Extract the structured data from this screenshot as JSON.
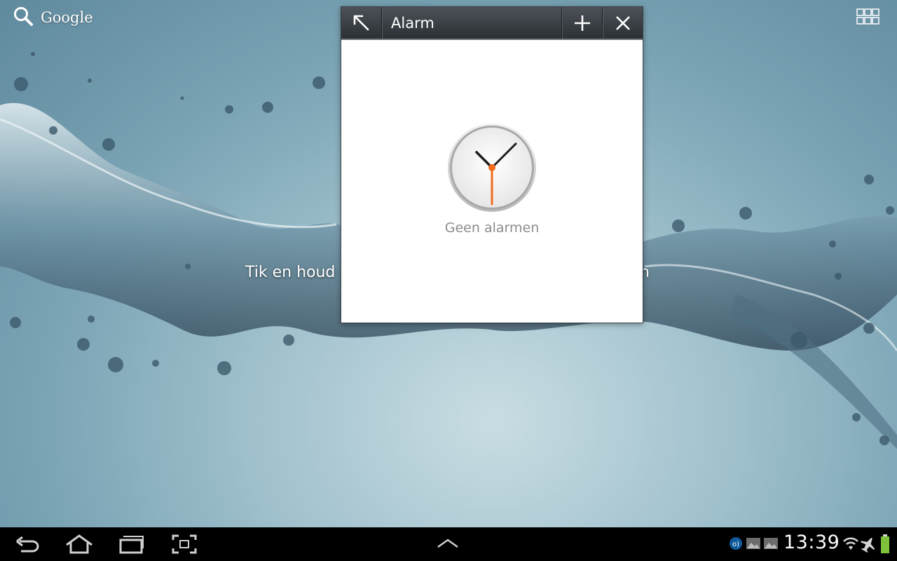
{
  "home": {
    "search_label": "Google",
    "hint_left": "Tik en houd",
    "hint_right": "n"
  },
  "widget": {
    "title": "Alarm",
    "empty_text": "Geen alarmen",
    "icons": [
      "expand-arrow-icon",
      "plus-icon",
      "close-icon",
      "clock-icon"
    ]
  },
  "status": {
    "time": "13:39",
    "battery_color": "#7ec23c"
  },
  "navigation": {
    "icons": [
      "back-icon",
      "home-icon",
      "recent-apps-icon",
      "screenshot-icon",
      "up-arrow-icon"
    ]
  }
}
